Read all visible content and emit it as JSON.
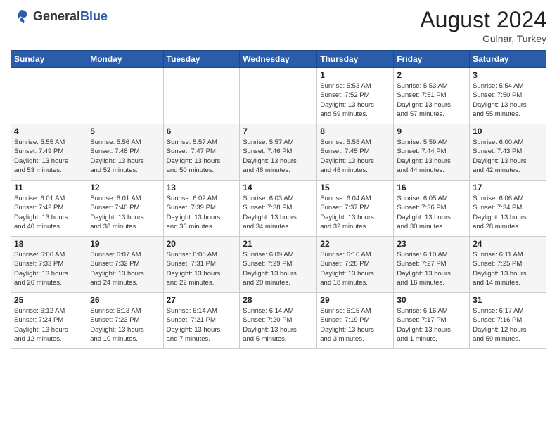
{
  "logo": {
    "text_general": "General",
    "text_blue": "Blue",
    "bird_color": "#2a5caa"
  },
  "header": {
    "month_year": "August 2024",
    "location": "Gulnar, Turkey"
  },
  "weekdays": [
    "Sunday",
    "Monday",
    "Tuesday",
    "Wednesday",
    "Thursday",
    "Friday",
    "Saturday"
  ],
  "weeks": [
    [
      {
        "day": "",
        "info": ""
      },
      {
        "day": "",
        "info": ""
      },
      {
        "day": "",
        "info": ""
      },
      {
        "day": "",
        "info": ""
      },
      {
        "day": "1",
        "info": "Sunrise: 5:53 AM\nSunset: 7:52 PM\nDaylight: 13 hours\nand 59 minutes."
      },
      {
        "day": "2",
        "info": "Sunrise: 5:53 AM\nSunset: 7:51 PM\nDaylight: 13 hours\nand 57 minutes."
      },
      {
        "day": "3",
        "info": "Sunrise: 5:54 AM\nSunset: 7:50 PM\nDaylight: 13 hours\nand 55 minutes."
      }
    ],
    [
      {
        "day": "4",
        "info": "Sunrise: 5:55 AM\nSunset: 7:49 PM\nDaylight: 13 hours\nand 53 minutes."
      },
      {
        "day": "5",
        "info": "Sunrise: 5:56 AM\nSunset: 7:48 PM\nDaylight: 13 hours\nand 52 minutes."
      },
      {
        "day": "6",
        "info": "Sunrise: 5:57 AM\nSunset: 7:47 PM\nDaylight: 13 hours\nand 50 minutes."
      },
      {
        "day": "7",
        "info": "Sunrise: 5:57 AM\nSunset: 7:46 PM\nDaylight: 13 hours\nand 48 minutes."
      },
      {
        "day": "8",
        "info": "Sunrise: 5:58 AM\nSunset: 7:45 PM\nDaylight: 13 hours\nand 46 minutes."
      },
      {
        "day": "9",
        "info": "Sunrise: 5:59 AM\nSunset: 7:44 PM\nDaylight: 13 hours\nand 44 minutes."
      },
      {
        "day": "10",
        "info": "Sunrise: 6:00 AM\nSunset: 7:43 PM\nDaylight: 13 hours\nand 42 minutes."
      }
    ],
    [
      {
        "day": "11",
        "info": "Sunrise: 6:01 AM\nSunset: 7:42 PM\nDaylight: 13 hours\nand 40 minutes."
      },
      {
        "day": "12",
        "info": "Sunrise: 6:01 AM\nSunset: 7:40 PM\nDaylight: 13 hours\nand 38 minutes."
      },
      {
        "day": "13",
        "info": "Sunrise: 6:02 AM\nSunset: 7:39 PM\nDaylight: 13 hours\nand 36 minutes."
      },
      {
        "day": "14",
        "info": "Sunrise: 6:03 AM\nSunset: 7:38 PM\nDaylight: 13 hours\nand 34 minutes."
      },
      {
        "day": "15",
        "info": "Sunrise: 6:04 AM\nSunset: 7:37 PM\nDaylight: 13 hours\nand 32 minutes."
      },
      {
        "day": "16",
        "info": "Sunrise: 6:05 AM\nSunset: 7:36 PM\nDaylight: 13 hours\nand 30 minutes."
      },
      {
        "day": "17",
        "info": "Sunrise: 6:06 AM\nSunset: 7:34 PM\nDaylight: 13 hours\nand 28 minutes."
      }
    ],
    [
      {
        "day": "18",
        "info": "Sunrise: 6:06 AM\nSunset: 7:33 PM\nDaylight: 13 hours\nand 26 minutes."
      },
      {
        "day": "19",
        "info": "Sunrise: 6:07 AM\nSunset: 7:32 PM\nDaylight: 13 hours\nand 24 minutes."
      },
      {
        "day": "20",
        "info": "Sunrise: 6:08 AM\nSunset: 7:31 PM\nDaylight: 13 hours\nand 22 minutes."
      },
      {
        "day": "21",
        "info": "Sunrise: 6:09 AM\nSunset: 7:29 PM\nDaylight: 13 hours\nand 20 minutes."
      },
      {
        "day": "22",
        "info": "Sunrise: 6:10 AM\nSunset: 7:28 PM\nDaylight: 13 hours\nand 18 minutes."
      },
      {
        "day": "23",
        "info": "Sunrise: 6:10 AM\nSunset: 7:27 PM\nDaylight: 13 hours\nand 16 minutes."
      },
      {
        "day": "24",
        "info": "Sunrise: 6:11 AM\nSunset: 7:25 PM\nDaylight: 13 hours\nand 14 minutes."
      }
    ],
    [
      {
        "day": "25",
        "info": "Sunrise: 6:12 AM\nSunset: 7:24 PM\nDaylight: 13 hours\nand 12 minutes."
      },
      {
        "day": "26",
        "info": "Sunrise: 6:13 AM\nSunset: 7:23 PM\nDaylight: 13 hours\nand 10 minutes."
      },
      {
        "day": "27",
        "info": "Sunrise: 6:14 AM\nSunset: 7:21 PM\nDaylight: 13 hours\nand 7 minutes."
      },
      {
        "day": "28",
        "info": "Sunrise: 6:14 AM\nSunset: 7:20 PM\nDaylight: 13 hours\nand 5 minutes."
      },
      {
        "day": "29",
        "info": "Sunrise: 6:15 AM\nSunset: 7:19 PM\nDaylight: 13 hours\nand 3 minutes."
      },
      {
        "day": "30",
        "info": "Sunrise: 6:16 AM\nSunset: 7:17 PM\nDaylight: 13 hours\nand 1 minute."
      },
      {
        "day": "31",
        "info": "Sunrise: 6:17 AM\nSunset: 7:16 PM\nDaylight: 12 hours\nand 59 minutes."
      }
    ]
  ]
}
